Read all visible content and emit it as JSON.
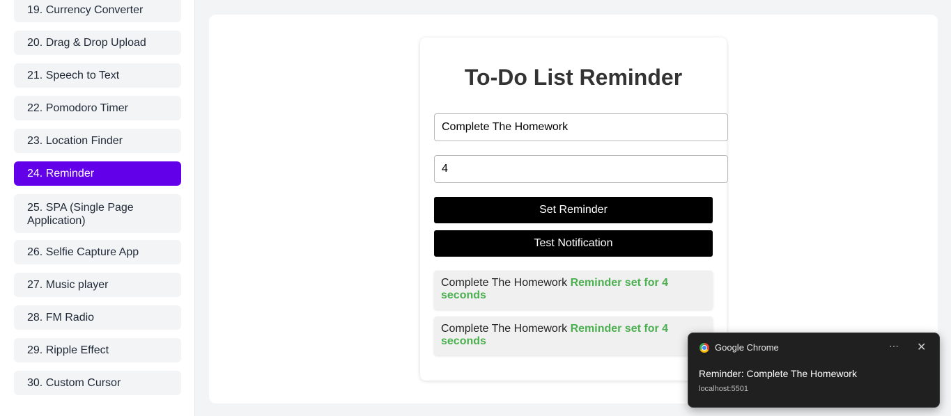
{
  "sidebar": {
    "items": [
      {
        "label": "19. Currency Converter"
      },
      {
        "label": "20. Drag & Drop Upload"
      },
      {
        "label": "21. Speech to Text"
      },
      {
        "label": "22. Pomodoro Timer"
      },
      {
        "label": "23. Location Finder"
      },
      {
        "label": "24. Reminder"
      },
      {
        "label": "25. SPA (Single Page Application)"
      },
      {
        "label": "26. Selfie Capture App"
      },
      {
        "label": "27. Music player"
      },
      {
        "label": "28. FM Radio"
      },
      {
        "label": "29. Ripple Effect"
      },
      {
        "label": "30. Custom Cursor"
      }
    ]
  },
  "app": {
    "title": "To-Do List Reminder",
    "task_value": "Complete The Homework",
    "seconds_value": "4",
    "set_button": "Set Reminder",
    "test_button": "Test Notification",
    "reminders": [
      {
        "task": "Complete The Homework",
        "status": "Reminder set for 4 seconds"
      },
      {
        "task": "Complete The Homework",
        "status": "Reminder set for 4 seconds"
      }
    ]
  },
  "notification": {
    "app_name": "Google Chrome",
    "more_icon": "⋯",
    "close_icon": "✕",
    "message": "Reminder: Complete The Homework",
    "source": "localhost:5501"
  },
  "colors": {
    "accent": "#6200ea",
    "status_green": "#4caf50"
  }
}
